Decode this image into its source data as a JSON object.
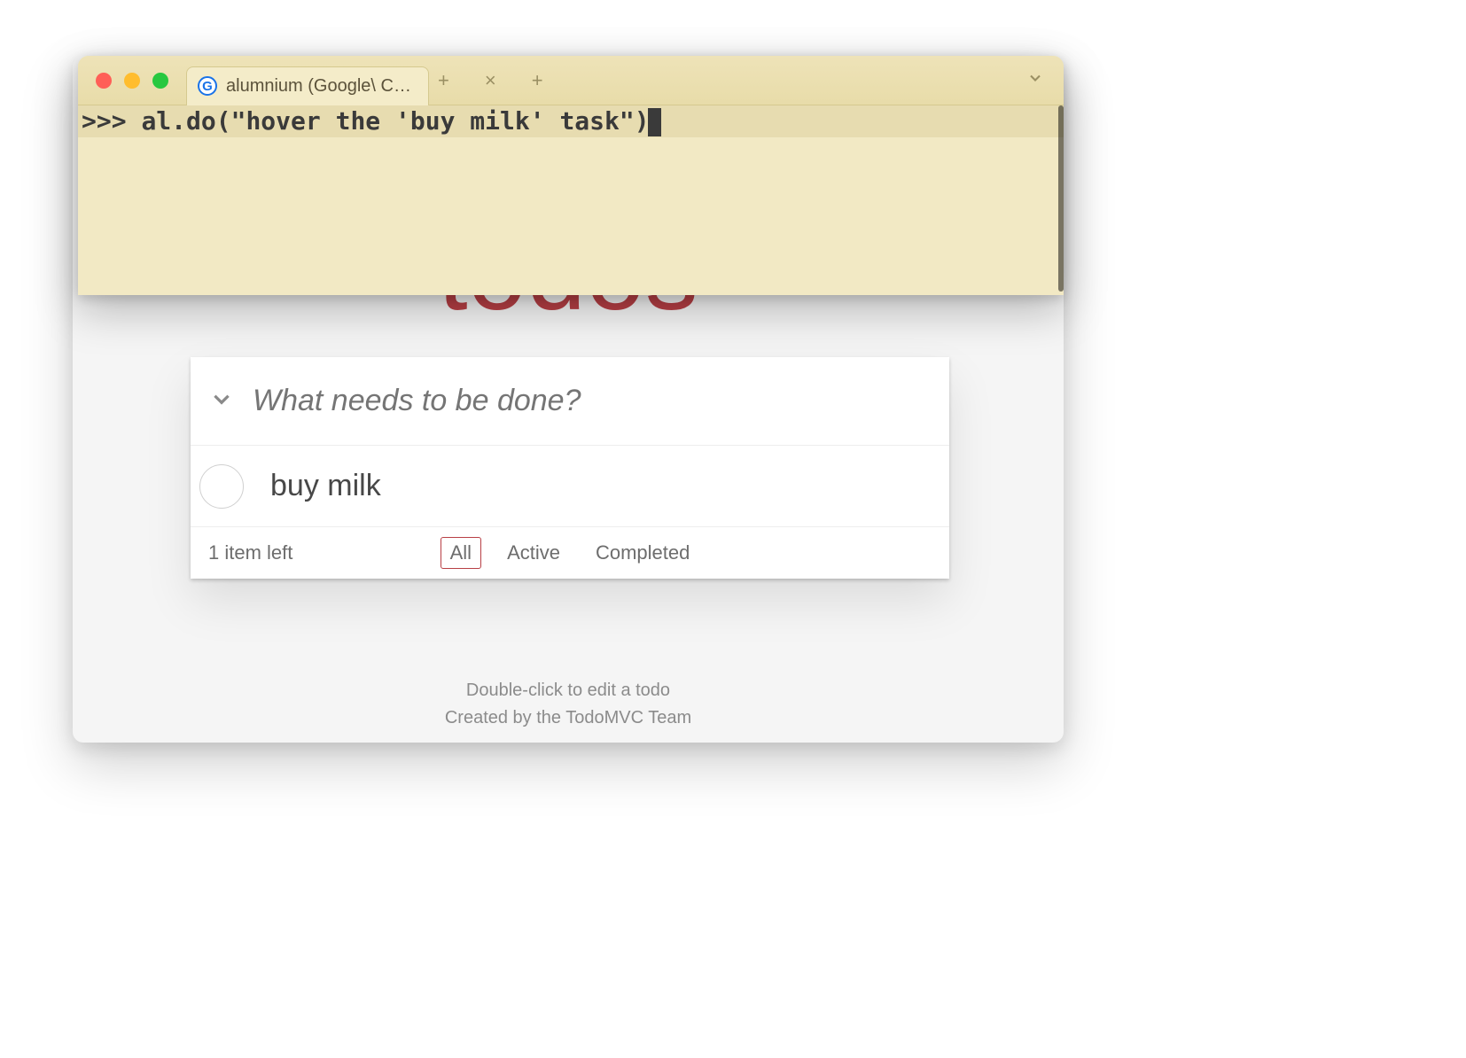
{
  "terminal": {
    "tab_title": "alumnium (Google\\ Chrom…",
    "favicon_letter": "G",
    "prompt": ">>> ",
    "command": "al.do(\"hover the 'buy milk' task\")"
  },
  "todo": {
    "title": "todos",
    "new_placeholder": "What needs to be done?",
    "items": [
      {
        "label": "buy milk",
        "completed": false
      }
    ],
    "count_text": "1 item left",
    "filters": {
      "all": "All",
      "active": "Active",
      "completed": "Completed",
      "selected": "all"
    }
  },
  "footer": {
    "line1": "Double-click to edit a todo",
    "line2": "Created by the TodoMVC Team"
  }
}
